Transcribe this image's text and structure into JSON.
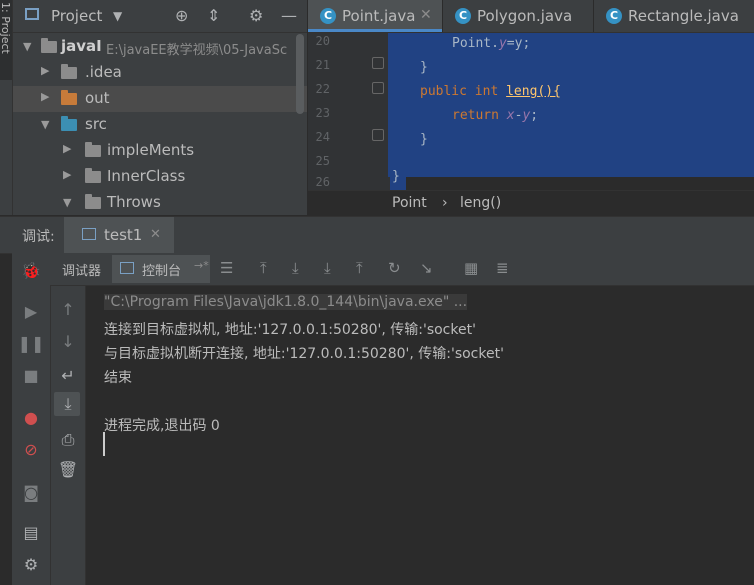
{
  "side_strip": {
    "label": "1: Project"
  },
  "project": {
    "title": "Project",
    "tree": [
      {
        "label": "javaI",
        "path": "E:\\javaEE教学视频\\05-JavaSc",
        "color": "#8c8c8c"
      },
      {
        "label": ".idea",
        "color": "#8c8c8c"
      },
      {
        "label": "out",
        "color": "#c77b3a"
      },
      {
        "label": "src",
        "color": "#3c8fb3"
      },
      {
        "label": "impleMents",
        "color": "#8c8c8c"
      },
      {
        "label": "InnerClass",
        "color": "#8c8c8c"
      },
      {
        "label": "Throws",
        "color": "#8c8c8c"
      }
    ]
  },
  "editor": {
    "tabs": [
      {
        "label": "Point.java",
        "icon": "C"
      },
      {
        "label": "Polygon.java",
        "icon": "C"
      },
      {
        "label": "Rectangle.java",
        "icon": "C"
      }
    ],
    "lines": [
      {
        "num": "20",
        "code_a": "Point.",
        "code_b": "y",
        "code_c": "=y;"
      },
      {
        "num": "21",
        "code": "}"
      },
      {
        "num": "22",
        "kw1": "public",
        "kw2": "int",
        "code": "leng(){"
      },
      {
        "num": "23",
        "kw": "return",
        "code_a": "x",
        "code_b": "-",
        "code_c": "y",
        "code_d": ";"
      },
      {
        "num": "24",
        "code": "}"
      },
      {
        "num": "25",
        "code": ""
      },
      {
        "num": "26",
        "code": "}"
      }
    ],
    "breadcrumb": {
      "item1": "Point",
      "sep": "›",
      "item2": "leng()"
    }
  },
  "debug": {
    "label": "调试:",
    "tab": {
      "label": "test1"
    },
    "subtabs": {
      "debugger": "调试器",
      "console": "控制台"
    }
  },
  "console": {
    "lines": [
      "\"C:\\Program Files\\Java\\jdk1.8.0_144\\bin\\java.exe\" ...",
      "连接到目标虚拟机, 地址:'127.0.0.1:50280', 传输:'socket'",
      "与目标虚拟机断开连接, 地址:'127.0.0.1:50280', 传输:'socket'",
      "结束",
      "",
      "进程完成,退出码 0"
    ]
  }
}
